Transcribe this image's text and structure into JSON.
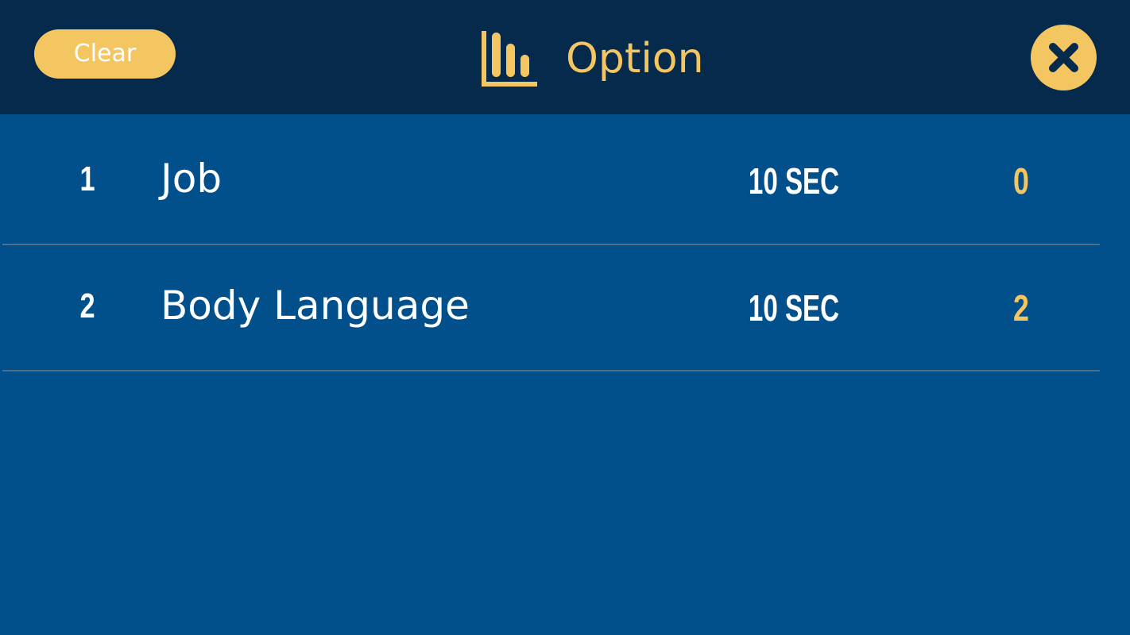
{
  "header": {
    "clear_label": "Clear",
    "title": "Option",
    "title_icon": "bar-chart-icon",
    "close_icon": "close-icon"
  },
  "colors": {
    "header_bg": "#062a4c",
    "body_bg": "#01508c",
    "accent": "#f4c661",
    "text": "#ffffff",
    "divider": "#4f6f8b"
  },
  "rows": [
    {
      "num": "1",
      "name": "Job",
      "time": "10 SEC",
      "score": "0"
    },
    {
      "num": "2",
      "name": "Body Language",
      "time": "10 SEC",
      "score": "2"
    }
  ]
}
